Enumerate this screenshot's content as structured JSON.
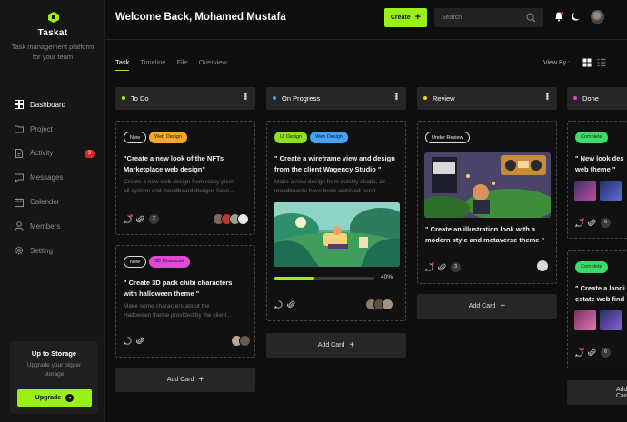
{
  "sidebar": {
    "brand": "Taskat",
    "tagline": "Task management platform for your team",
    "items": [
      {
        "label": "Dashboard",
        "icon": "dashboard-icon",
        "active": true
      },
      {
        "label": "Project",
        "icon": "folder-icon"
      },
      {
        "label": "Activity",
        "icon": "activity-icon",
        "badge": "3"
      },
      {
        "label": "Messages",
        "icon": "message-icon"
      },
      {
        "label": "Calender",
        "icon": "calendar-icon"
      },
      {
        "label": "Members",
        "icon": "user-icon"
      },
      {
        "label": "Setting",
        "icon": "gear-icon"
      }
    ],
    "storage": {
      "title": "Up to Storage",
      "text": "Upgrade your bigger storage",
      "button": "Upgrade"
    }
  },
  "header": {
    "welcome": "Welcome Back, Mohamed Mustafa",
    "create_label": "Create",
    "search_placeholder": "Search"
  },
  "tabs": [
    "Task",
    "Timeline",
    "File",
    "Overview"
  ],
  "view_by_label": "View By :",
  "colors": {
    "accent": "#9cf01a",
    "todo": "#9cf01a",
    "progress": "#45a2f5",
    "review": "#f5d90a",
    "done": "#e447d6"
  },
  "columns": {
    "todo": {
      "title": "To Do",
      "add_label": "Add Card",
      "card1": {
        "tags": [
          "New",
          "Web Design"
        ],
        "title_line1": "\"Create a new look of the NFTs",
        "title_line2": "Marketplace web design\"",
        "desc_line1": "Create a new web design from rocky pixel",
        "desc_line2": "all system and moodboard designs have...",
        "count": "2"
      },
      "card2": {
        "tags": [
          "New",
          "3D Character"
        ],
        "title_line1": "\" Create 3D pack chibi characters",
        "title_line2": "with halloween theme \"",
        "desc_line1": "Make some characters about the",
        "desc_line2": "Halloween theme provided by the client..."
      }
    },
    "progress": {
      "title": "On Progress",
      "add_label": "Add Card",
      "card1": {
        "tags": [
          "UI Design",
          "Web Design"
        ],
        "title_line1": "\" Create a wireframe view and design",
        "title_line2": "from the client Wagency Studio \"",
        "desc_line1": "Make a new design from quickly studio, all",
        "desc_line2": "moodboards have been archived heret",
        "progress": 0.4,
        "progress_label": "40%"
      }
    },
    "review": {
      "title": "Review",
      "add_label": "Add Card",
      "card1": {
        "tags": [
          "Under Review"
        ],
        "title_line1": "\" Create an illustration look with a",
        "title_line2": "modern style and metaverse theme \"",
        "count": "3"
      }
    },
    "done": {
      "title": "Done",
      "add_label": "Add Card",
      "card1": {
        "tags": [
          "Complete"
        ],
        "title_line1": "\" New look des",
        "title_line2": "web theme \"",
        "count": "6"
      },
      "card2": {
        "tags": [
          "Complete"
        ],
        "title_line1": "\" Create a landi",
        "title_line2": "estate web find",
        "count": "6"
      }
    }
  }
}
